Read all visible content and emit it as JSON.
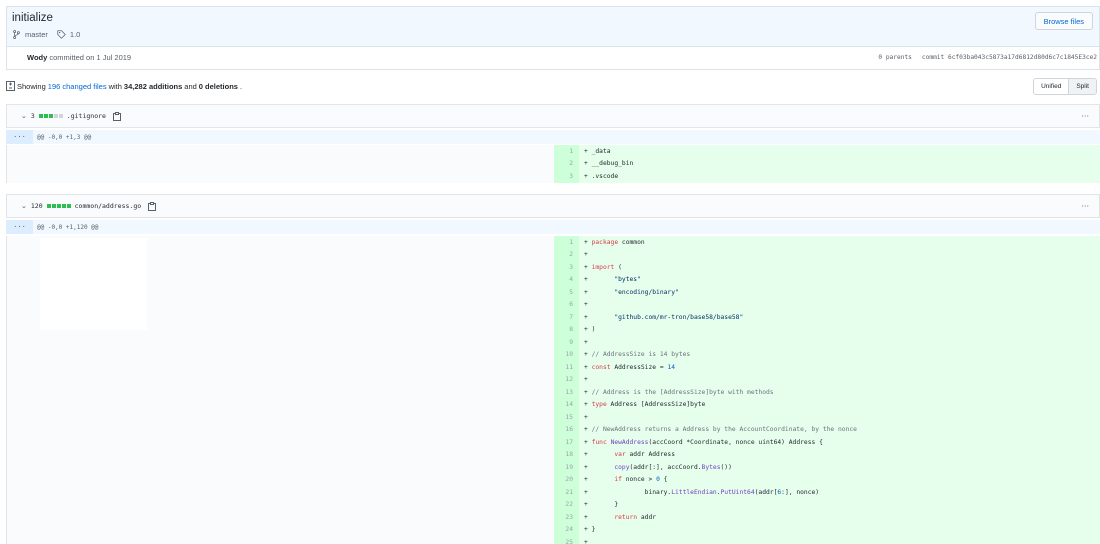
{
  "commit": {
    "title": "initialize",
    "branch": "master",
    "tag": "1.0",
    "browse_label": "Browse files",
    "author": "Wody",
    "committed_text": "committed on 1 Jul 2019",
    "parents": "0 parents",
    "sha": "commit 6cf03ba043c5873a17d6812d80d6c7c1845E3ce2"
  },
  "summary": {
    "showing": "Showing",
    "changed_files": "196 changed files",
    "with": "with",
    "additions": "34,282 additions",
    "and": "and",
    "deletions": "0 deletions",
    "period": ".",
    "unified_label": "Unified",
    "split_label": "Split"
  },
  "files": [
    {
      "count": "3",
      "name": ".gitignore",
      "hunk": "@@ -0,0 +1,3 @@",
      "lines": [
        {
          "n": "1",
          "t": "+ _data"
        },
        {
          "n": "2",
          "t": "+ __debug_bin"
        },
        {
          "n": "3",
          "t": "+ .vscode"
        }
      ]
    },
    {
      "count": "120",
      "name": "common/address.go",
      "hunk": "@@ -0,0 +1,120 @@",
      "lines": [
        {
          "n": "1",
          "t": "+ package common"
        },
        {
          "n": "2",
          "t": "+"
        },
        {
          "n": "3",
          "t": "+ import ("
        },
        {
          "n": "4",
          "t": "+       \"bytes\""
        },
        {
          "n": "5",
          "t": "+       \"encoding/binary\""
        },
        {
          "n": "6",
          "t": "+"
        },
        {
          "n": "7",
          "t": "+       \"github.com/mr-tron/base58/base58\""
        },
        {
          "n": "8",
          "t": "+ )"
        },
        {
          "n": "9",
          "t": "+"
        },
        {
          "n": "10",
          "t": "+ // AddressSize is 14 bytes"
        },
        {
          "n": "11",
          "t": "+ const AddressSize = 14"
        },
        {
          "n": "12",
          "t": "+"
        },
        {
          "n": "13",
          "t": "+ // Address is the [AddressSize]byte with methods"
        },
        {
          "n": "14",
          "t": "+ type Address [AddressSize]byte"
        },
        {
          "n": "15",
          "t": "+"
        },
        {
          "n": "16",
          "t": "+ // NewAddress returns a Address by the AccountCoordinate, by the nonce"
        },
        {
          "n": "17",
          "t": "+ func NewAddress(accCoord *Coordinate, nonce uint64) Address {"
        },
        {
          "n": "18",
          "t": "+       var addr Address"
        },
        {
          "n": "19",
          "t": "+       copy(addr[:], accCoord.Bytes())"
        },
        {
          "n": "20",
          "t": "+       if nonce > 0 {"
        },
        {
          "n": "21",
          "t": "+               binary.LittleEndian.PutUint64(addr[6:], nonce)"
        },
        {
          "n": "22",
          "t": "+       }"
        },
        {
          "n": "23",
          "t": "+       return addr"
        },
        {
          "n": "24",
          "t": "+ }"
        },
        {
          "n": "25",
          "t": "+"
        }
      ]
    }
  ],
  "icons": {
    "branch": "git-branch-icon",
    "tag": "tag-icon",
    "copy": "clipboard-icon",
    "chevron": "chevron-down-icon",
    "kebab": "kebab-horizontal-icon",
    "expand": "unfold-icon"
  },
  "colors": {
    "addition_bg": "#e6ffed",
    "addition_num_bg": "#cdffd8",
    "link": "#0366d6",
    "diffstat_green": "#2cbe4e"
  }
}
